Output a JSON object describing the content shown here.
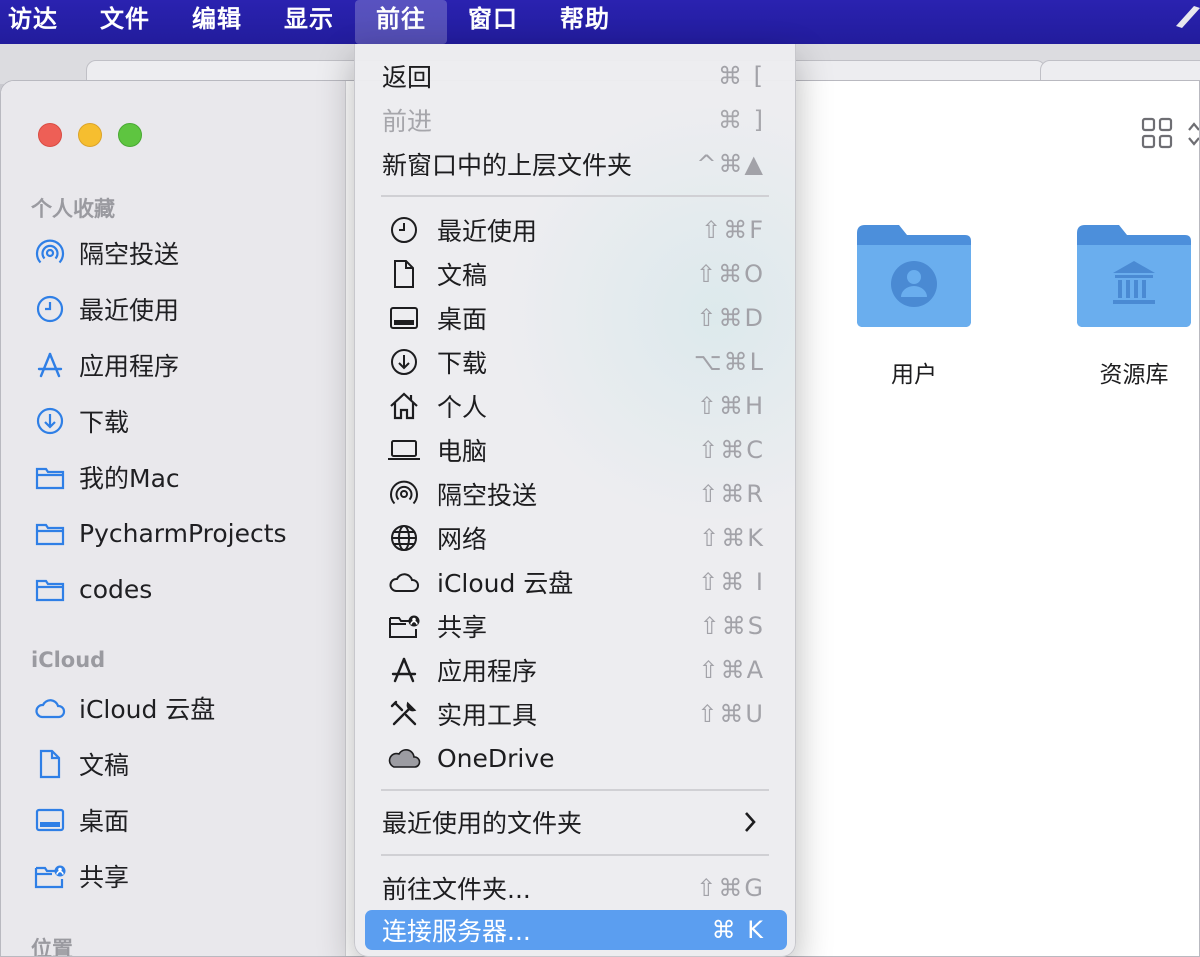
{
  "menubar": {
    "items": [
      "访达",
      "文件",
      "编辑",
      "显示",
      "前往",
      "窗口",
      "帮助"
    ],
    "active_index": 4
  },
  "sidebar": {
    "section_favorites": "个人收藏",
    "favorites": [
      {
        "label": "隔空投送",
        "icon": "airdrop-icon"
      },
      {
        "label": "最近使用",
        "icon": "clock-icon"
      },
      {
        "label": "应用程序",
        "icon": "applications-icon"
      },
      {
        "label": "下载",
        "icon": "download-icon"
      },
      {
        "label": "我的Mac",
        "icon": "folder-icon"
      },
      {
        "label": "PycharmProjects",
        "icon": "folder-icon"
      },
      {
        "label": "codes",
        "icon": "folder-icon"
      }
    ],
    "section_icloud": "iCloud",
    "icloud": [
      {
        "label": "iCloud 云盘",
        "icon": "cloud-icon"
      },
      {
        "label": "文稿",
        "icon": "document-icon"
      },
      {
        "label": "桌面",
        "icon": "desktop-icon"
      },
      {
        "label": "共享",
        "icon": "shared-folder-icon"
      }
    ],
    "section_locations": "位置"
  },
  "content": {
    "folders": [
      {
        "label": "用户",
        "icon": "users-folder-icon"
      },
      {
        "label": "资源库",
        "icon": "library-folder-icon"
      }
    ]
  },
  "menu": {
    "top_items": [
      {
        "label": "返回",
        "shortcut": "⌘ [",
        "disabled": false
      },
      {
        "label": "前进",
        "shortcut": "⌘ ]",
        "disabled": true
      },
      {
        "label": "新窗口中的上层文件夹",
        "shortcut": "^⌘▲",
        "disabled": false
      }
    ],
    "places": [
      {
        "label": "最近使用",
        "shortcut": "⇧⌘F",
        "icon": "clock-icon"
      },
      {
        "label": "文稿",
        "shortcut": "⇧⌘O",
        "icon": "document-icon"
      },
      {
        "label": "桌面",
        "shortcut": "⇧⌘D",
        "icon": "desktop-icon"
      },
      {
        "label": "下载",
        "shortcut": "⌥⌘L",
        "icon": "download-icon"
      },
      {
        "label": "个人",
        "shortcut": "⇧⌘H",
        "icon": "home-icon"
      },
      {
        "label": "电脑",
        "shortcut": "⇧⌘C",
        "icon": "laptop-icon"
      },
      {
        "label": "隔空投送",
        "shortcut": "⇧⌘R",
        "icon": "airdrop-icon"
      },
      {
        "label": "网络",
        "shortcut": "⇧⌘K",
        "icon": "globe-icon"
      },
      {
        "label": "iCloud 云盘",
        "shortcut": "⇧⌘ I",
        "icon": "cloud-icon"
      },
      {
        "label": "共享",
        "shortcut": "⇧⌘S",
        "icon": "shared-folder-icon"
      },
      {
        "label": "应用程序",
        "shortcut": "⇧⌘A",
        "icon": "applications-icon"
      },
      {
        "label": "实用工具",
        "shortcut": "⇧⌘U",
        "icon": "tools-icon"
      },
      {
        "label": "OneDrive",
        "shortcut": "",
        "icon": "onedrive-cloud-icon"
      }
    ],
    "recent_folders": "最近使用的文件夹",
    "goto_folder": {
      "label": "前往文件夹...",
      "shortcut": "⇧⌘G"
    },
    "connect_server": {
      "label": "连接服务器...",
      "shortcut": "⌘ K"
    }
  },
  "colors": {
    "menubar": "#2a22b0",
    "highlight": "#5b9ef0",
    "sidebar_icon": "#2f7fe6",
    "folder": "#5ea3e8"
  }
}
